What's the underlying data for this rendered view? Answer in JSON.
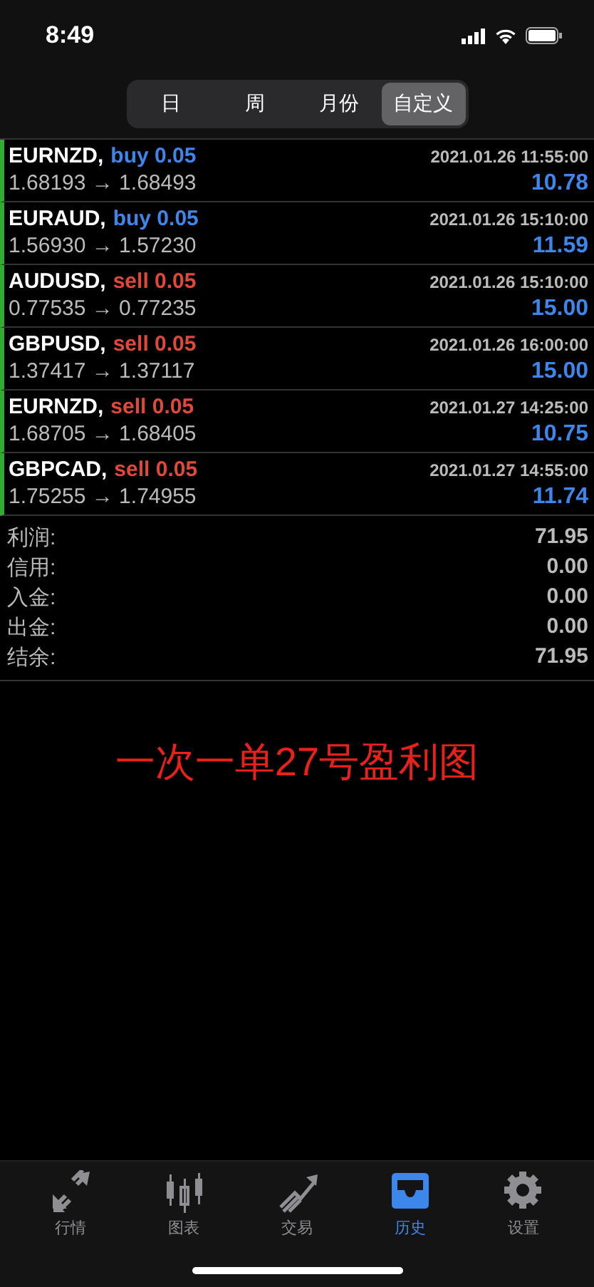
{
  "status_bar": {
    "time": "8:49"
  },
  "periods": [
    {
      "label": "日",
      "selected": false
    },
    {
      "label": "周",
      "selected": false
    },
    {
      "label": "月份",
      "selected": false
    },
    {
      "label": "自定义",
      "selected": true
    }
  ],
  "trades": [
    {
      "symbol": "EURNZD,",
      "kind": "buy",
      "order": "buy 0.05",
      "time": "2021.01.26 11:55:00",
      "prices": "1.68193 → 1.68493",
      "profit": "10.78"
    },
    {
      "symbol": "EURAUD,",
      "kind": "buy",
      "order": "buy 0.05",
      "time": "2021.01.26 15:10:00",
      "prices": "1.56930 → 1.57230",
      "profit": "11.59"
    },
    {
      "symbol": "AUDUSD,",
      "kind": "sell",
      "order": "sell 0.05",
      "time": "2021.01.26 15:10:00",
      "prices": "0.77535 → 0.77235",
      "profit": "15.00"
    },
    {
      "symbol": "GBPUSD,",
      "kind": "sell",
      "order": "sell 0.05",
      "time": "2021.01.26 16:00:00",
      "prices": "1.37417 → 1.37117",
      "profit": "15.00"
    },
    {
      "symbol": "EURNZD,",
      "kind": "sell",
      "order": "sell 0.05",
      "time": "2021.01.27 14:25:00",
      "prices": "1.68705 → 1.68405",
      "profit": "10.75"
    },
    {
      "symbol": "GBPCAD,",
      "kind": "sell",
      "order": "sell 0.05",
      "time": "2021.01.27 14:55:00",
      "prices": "1.75255 → 1.74955",
      "profit": "11.74"
    }
  ],
  "summary": [
    {
      "label": "利润:",
      "value": "71.95"
    },
    {
      "label": "信用:",
      "value": "0.00"
    },
    {
      "label": "入金:",
      "value": "0.00"
    },
    {
      "label": "出金:",
      "value": "0.00"
    },
    {
      "label": "结余:",
      "value": "71.95"
    }
  ],
  "annotation": "一次一单27号盈利图",
  "tab_bar": [
    {
      "kind": "quotes",
      "label": "行情",
      "selected": false
    },
    {
      "kind": "chart",
      "label": "图表",
      "selected": false
    },
    {
      "kind": "trade",
      "label": "交易",
      "selected": false
    },
    {
      "kind": "history",
      "label": "历史",
      "selected": true
    },
    {
      "kind": "settings",
      "label": "设置",
      "selected": false
    }
  ]
}
